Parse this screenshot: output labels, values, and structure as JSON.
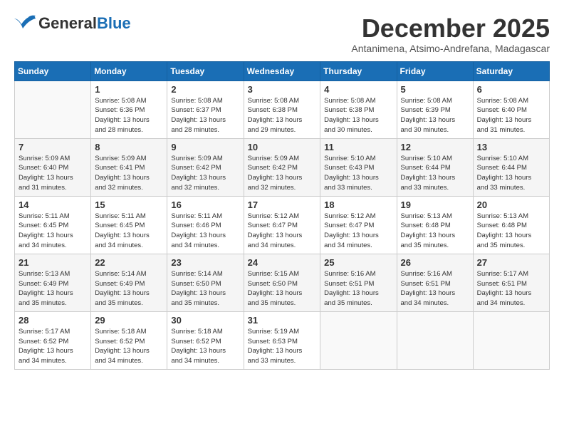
{
  "header": {
    "logo_general": "General",
    "logo_blue": "Blue",
    "month_title": "December 2025",
    "location": "Antanimena, Atsimo-Andrefana, Madagascar"
  },
  "days_of_week": [
    "Sunday",
    "Monday",
    "Tuesday",
    "Wednesday",
    "Thursday",
    "Friday",
    "Saturday"
  ],
  "weeks": [
    [
      {
        "day": "",
        "info": ""
      },
      {
        "day": "1",
        "info": "Sunrise: 5:08 AM\nSunset: 6:36 PM\nDaylight: 13 hours\nand 28 minutes."
      },
      {
        "day": "2",
        "info": "Sunrise: 5:08 AM\nSunset: 6:37 PM\nDaylight: 13 hours\nand 28 minutes."
      },
      {
        "day": "3",
        "info": "Sunrise: 5:08 AM\nSunset: 6:38 PM\nDaylight: 13 hours\nand 29 minutes."
      },
      {
        "day": "4",
        "info": "Sunrise: 5:08 AM\nSunset: 6:38 PM\nDaylight: 13 hours\nand 30 minutes."
      },
      {
        "day": "5",
        "info": "Sunrise: 5:08 AM\nSunset: 6:39 PM\nDaylight: 13 hours\nand 30 minutes."
      },
      {
        "day": "6",
        "info": "Sunrise: 5:08 AM\nSunset: 6:40 PM\nDaylight: 13 hours\nand 31 minutes."
      }
    ],
    [
      {
        "day": "7",
        "info": "Sunrise: 5:09 AM\nSunset: 6:40 PM\nDaylight: 13 hours\nand 31 minutes."
      },
      {
        "day": "8",
        "info": "Sunrise: 5:09 AM\nSunset: 6:41 PM\nDaylight: 13 hours\nand 32 minutes."
      },
      {
        "day": "9",
        "info": "Sunrise: 5:09 AM\nSunset: 6:42 PM\nDaylight: 13 hours\nand 32 minutes."
      },
      {
        "day": "10",
        "info": "Sunrise: 5:09 AM\nSunset: 6:42 PM\nDaylight: 13 hours\nand 32 minutes."
      },
      {
        "day": "11",
        "info": "Sunrise: 5:10 AM\nSunset: 6:43 PM\nDaylight: 13 hours\nand 33 minutes."
      },
      {
        "day": "12",
        "info": "Sunrise: 5:10 AM\nSunset: 6:44 PM\nDaylight: 13 hours\nand 33 minutes."
      },
      {
        "day": "13",
        "info": "Sunrise: 5:10 AM\nSunset: 6:44 PM\nDaylight: 13 hours\nand 33 minutes."
      }
    ],
    [
      {
        "day": "14",
        "info": "Sunrise: 5:11 AM\nSunset: 6:45 PM\nDaylight: 13 hours\nand 34 minutes."
      },
      {
        "day": "15",
        "info": "Sunrise: 5:11 AM\nSunset: 6:45 PM\nDaylight: 13 hours\nand 34 minutes."
      },
      {
        "day": "16",
        "info": "Sunrise: 5:11 AM\nSunset: 6:46 PM\nDaylight: 13 hours\nand 34 minutes."
      },
      {
        "day": "17",
        "info": "Sunrise: 5:12 AM\nSunset: 6:47 PM\nDaylight: 13 hours\nand 34 minutes."
      },
      {
        "day": "18",
        "info": "Sunrise: 5:12 AM\nSunset: 6:47 PM\nDaylight: 13 hours\nand 34 minutes."
      },
      {
        "day": "19",
        "info": "Sunrise: 5:13 AM\nSunset: 6:48 PM\nDaylight: 13 hours\nand 35 minutes."
      },
      {
        "day": "20",
        "info": "Sunrise: 5:13 AM\nSunset: 6:48 PM\nDaylight: 13 hours\nand 35 minutes."
      }
    ],
    [
      {
        "day": "21",
        "info": "Sunrise: 5:13 AM\nSunset: 6:49 PM\nDaylight: 13 hours\nand 35 minutes."
      },
      {
        "day": "22",
        "info": "Sunrise: 5:14 AM\nSunset: 6:49 PM\nDaylight: 13 hours\nand 35 minutes."
      },
      {
        "day": "23",
        "info": "Sunrise: 5:14 AM\nSunset: 6:50 PM\nDaylight: 13 hours\nand 35 minutes."
      },
      {
        "day": "24",
        "info": "Sunrise: 5:15 AM\nSunset: 6:50 PM\nDaylight: 13 hours\nand 35 minutes."
      },
      {
        "day": "25",
        "info": "Sunrise: 5:16 AM\nSunset: 6:51 PM\nDaylight: 13 hours\nand 35 minutes."
      },
      {
        "day": "26",
        "info": "Sunrise: 5:16 AM\nSunset: 6:51 PM\nDaylight: 13 hours\nand 34 minutes."
      },
      {
        "day": "27",
        "info": "Sunrise: 5:17 AM\nSunset: 6:51 PM\nDaylight: 13 hours\nand 34 minutes."
      }
    ],
    [
      {
        "day": "28",
        "info": "Sunrise: 5:17 AM\nSunset: 6:52 PM\nDaylight: 13 hours\nand 34 minutes."
      },
      {
        "day": "29",
        "info": "Sunrise: 5:18 AM\nSunset: 6:52 PM\nDaylight: 13 hours\nand 34 minutes."
      },
      {
        "day": "30",
        "info": "Sunrise: 5:18 AM\nSunset: 6:52 PM\nDaylight: 13 hours\nand 34 minutes."
      },
      {
        "day": "31",
        "info": "Sunrise: 5:19 AM\nSunset: 6:53 PM\nDaylight: 13 hours\nand 33 minutes."
      },
      {
        "day": "",
        "info": ""
      },
      {
        "day": "",
        "info": ""
      },
      {
        "day": "",
        "info": ""
      }
    ]
  ]
}
